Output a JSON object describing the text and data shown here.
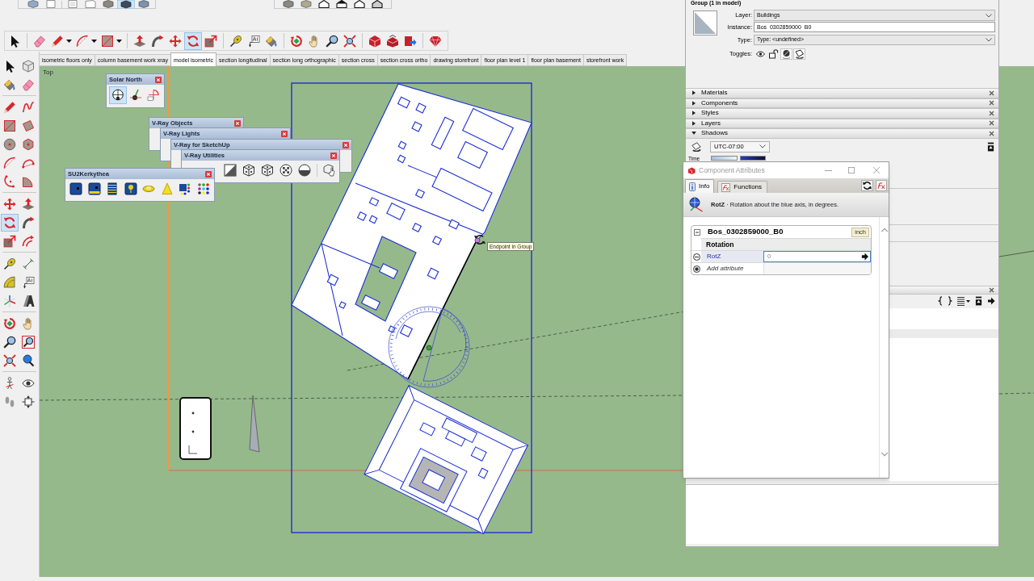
{
  "views_toolbar": {
    "tools": [
      {
        "selected": false
      },
      {
        "selected": false
      },
      {
        "selected": false
      },
      {
        "selected": false
      },
      {
        "selected": false
      },
      {
        "selected": true
      },
      {
        "selected": false
      }
    ]
  },
  "main_toolbar": {
    "tools": [
      {
        "selected": false
      },
      {
        "selected": false
      },
      {
        "selected": false
      },
      {
        "selected": false
      },
      {
        "selected": false
      },
      {
        "selected": false
      },
      {
        "selected": false
      },
      {
        "selected": false
      },
      {
        "selected": true
      },
      {
        "selected": false
      },
      {
        "selected": false
      },
      {
        "selected": false
      },
      {
        "selected": false
      },
      {
        "selected": false
      },
      {
        "selected": false
      },
      {
        "selected": false
      },
      {
        "selected": false
      },
      {
        "selected": false
      },
      {
        "selected": false
      },
      {
        "selected": false
      },
      {
        "selected": false
      }
    ]
  },
  "scene_tabs": [
    {
      "label": "isometric floors only",
      "selected": false
    },
    {
      "label": "column basement work xray",
      "selected": false
    },
    {
      "label": "model isometric",
      "selected": true
    },
    {
      "label": "section longitudinal",
      "selected": false
    },
    {
      "label": "section long orthographic",
      "selected": false
    },
    {
      "label": "section cross",
      "selected": false
    },
    {
      "label": "section cross ortho",
      "selected": false
    },
    {
      "label": "drawing storefront",
      "selected": false
    },
    {
      "label": "floor plan level 1",
      "selected": false
    },
    {
      "label": "floor plan basement",
      "selected": false
    },
    {
      "label": "storefront work",
      "selected": false
    }
  ],
  "left_toolbar": {
    "tools": [
      {
        "selected": false
      },
      {
        "selected": false
      },
      {
        "selected": false
      },
      {
        "selected": false
      },
      {
        "selected": false
      },
      {
        "selected": false
      },
      {
        "selected": false
      },
      {
        "selected": false
      },
      {
        "selected": false
      },
      {
        "selected": false
      },
      {
        "selected": false
      },
      {
        "selected": false
      },
      {
        "selected": false
      },
      {
        "selected": false
      },
      {
        "selected": false
      },
      {
        "selected": false
      },
      {
        "selected": true
      },
      {
        "selected": false
      },
      {
        "selected": false
      },
      {
        "selected": false
      },
      {
        "selected": false
      },
      {
        "selected": false
      },
      {
        "selected": false
      },
      {
        "selected": false
      },
      {
        "selected": false
      },
      {
        "selected": false
      },
      {
        "selected": false
      },
      {
        "selected": false
      },
      {
        "selected": false
      },
      {
        "selected": false
      },
      {
        "selected": false
      },
      {
        "selected": false
      },
      {
        "selected": false
      },
      {
        "selected": false
      },
      {
        "selected": false
      },
      {
        "selected": false
      }
    ]
  },
  "viewport": {
    "view_label": "Top",
    "tooltip": "Endpoint in Group"
  },
  "floating_toolbars": [
    {
      "title": "Solar North",
      "tools": [
        {
          "selected": true
        },
        {
          "selected": false
        },
        {
          "selected": false
        }
      ]
    },
    {
      "title": "V-Ray Objects"
    },
    {
      "title": "V-Ray Lights"
    },
    {
      "title": "V-Ray for SketchUp"
    },
    {
      "title": "V-Ray Utilities"
    },
    {
      "title": "SU2Kerkythea"
    }
  ],
  "entity_info": {
    "header": "Group (1 in model)",
    "fields": [
      {
        "kind": "dropdown",
        "label": "Layer:",
        "value": "Buildings"
      },
      {
        "kind": "text",
        "label": "Instance:",
        "value": "Bos_0302859000_B0"
      },
      {
        "kind": "dropdown",
        "label": "Type:",
        "value": "Type: <undefined>"
      }
    ],
    "toggles": {
      "label": "Toggles:",
      "items": [
        {
          "on": false
        },
        {
          "on": false
        },
        {
          "on": true
        },
        {
          "on": true
        }
      ]
    }
  },
  "tray_panels": [
    {
      "title": "Materials",
      "expanded": false
    },
    {
      "title": "Components",
      "expanded": false
    },
    {
      "title": "Styles",
      "expanded": false
    },
    {
      "title": "Layers",
      "expanded": false
    },
    {
      "title": "Shadows",
      "expanded": true
    }
  ],
  "shadows": {
    "time_zone": "UTC-07:00",
    "time_label": "Time"
  },
  "component_attributes": {
    "title": "Component Attributes",
    "tabs": [
      {
        "label": "Info",
        "selected": true
      },
      {
        "label": "Functions",
        "selected": false
      }
    ],
    "info": "**RotZ** · Rotation about the blue axis, in degrees.",
    "component": {
      "name": "Bos_0302859000_B0",
      "units": "inch",
      "sections": [
        {
          "title": "Rotation",
          "attributes": [
            {
              "name": "RotZ",
              "value": "0"
            }
          ]
        }
      ],
      "add_label": "Add attribute"
    }
  }
}
